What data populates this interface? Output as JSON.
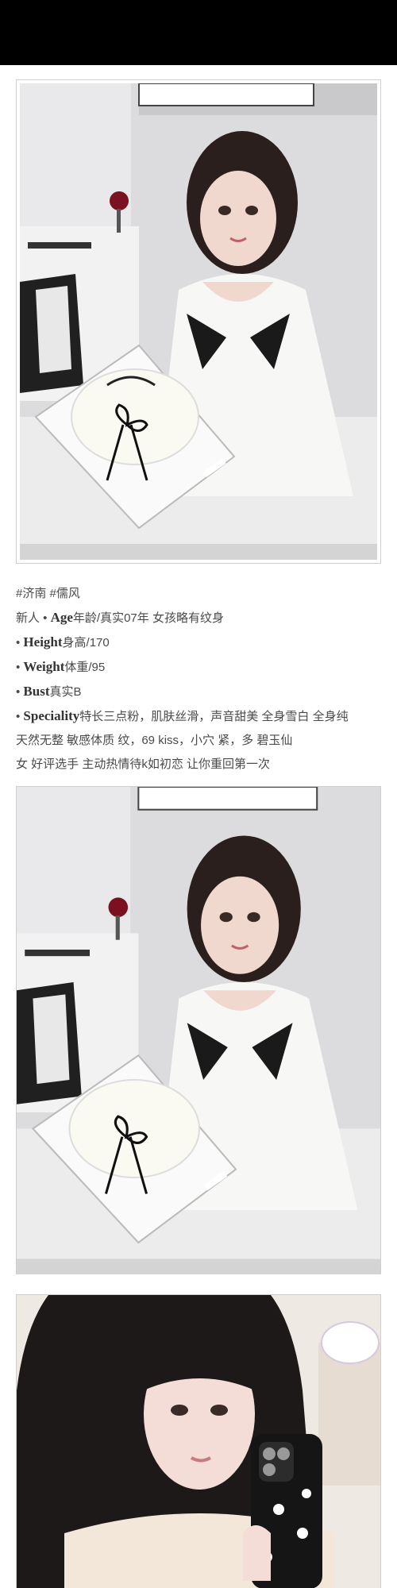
{
  "profile": {
    "tags": "#济南 #儒风",
    "line_age_prefix": "新人 • ",
    "age_key": "Age",
    "age_value": "年龄/真实07年 女孩略有纹身",
    "bullet": "• ",
    "height_key": "Height",
    "height_value": "身高/170",
    "weight_key": "Weight",
    "weight_value": "体重/95",
    "bust_key": "Bust",
    "bust_value": "真实B",
    "speciality_key": "Speciality",
    "speciality_value": "特长三点粉，肌肤丝滑，声音甜美 全身雪白 全身纯",
    "speciality_line2": "天然无整  敏感体质  纹，69  kiss，小穴 紧，多 碧玉仙",
    "speciality_line3": "女 好评选手 主动热情待k如初恋 让你重回第一次"
  },
  "photos": [
    {
      "name": "photo-girl-with-cake-1"
    },
    {
      "name": "photo-girl-with-cake-2"
    },
    {
      "name": "photo-girl-with-phone"
    }
  ]
}
